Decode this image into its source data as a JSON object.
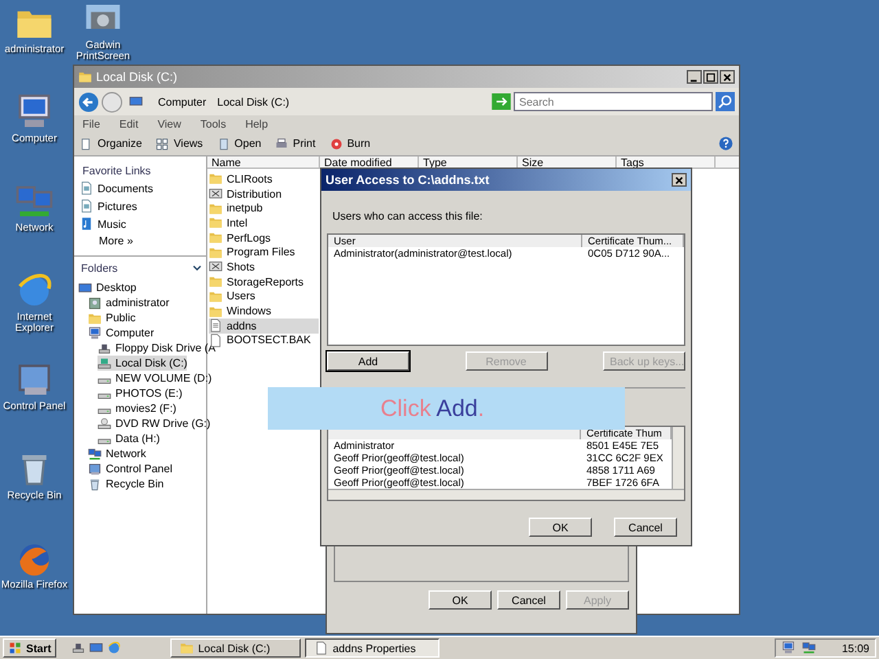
{
  "desktop_icons": [
    {
      "label": "administrator",
      "kind": "folder"
    },
    {
      "label": "Gadwin PrintScreen",
      "kind": "camera"
    },
    {
      "label": "Computer",
      "kind": "computer"
    },
    {
      "label": "Network",
      "kind": "network"
    },
    {
      "label": "Internet Explorer",
      "kind": "ie"
    },
    {
      "label": "Control Panel",
      "kind": "control"
    },
    {
      "label": "Recycle Bin",
      "kind": "bin"
    },
    {
      "label": "Mozilla Firefox",
      "kind": "firefox"
    }
  ],
  "explorer": {
    "title": "Local Disk (C:)",
    "address": [
      "Computer",
      "Local Disk (C:)"
    ],
    "search": {
      "placeholder": "Search"
    },
    "menu": [
      "File",
      "Edit",
      "View",
      "Tools",
      "Help"
    ],
    "toolbar": [
      {
        "label": "Organize",
        "kind": "organize"
      },
      {
        "label": "Views",
        "kind": "views"
      },
      {
        "label": "Open",
        "kind": "open"
      },
      {
        "label": "Print",
        "kind": "print"
      },
      {
        "label": "Burn",
        "kind": "burn"
      }
    ],
    "favorite_links": {
      "title": "Favorite Links",
      "items": [
        {
          "label": "Documents",
          "kind": "doc"
        },
        {
          "label": "Pictures",
          "kind": "doc"
        },
        {
          "label": "Music",
          "kind": "music"
        }
      ],
      "more": "More  »"
    },
    "folders": {
      "title": "Folders",
      "tree": [
        {
          "label": "Desktop",
          "kind": "desktop",
          "selected": false,
          "children": [
            {
              "label": "administrator",
              "kind": "user",
              "selected": false
            },
            {
              "label": "Public",
              "kind": "folder",
              "selected": false
            },
            {
              "label": "Computer",
              "kind": "computer",
              "selected": false,
              "children": [
                {
                  "label": "Floppy Disk Drive (A",
                  "kind": "floppy",
                  "selected": false
                },
                {
                  "label": "Local Disk (C:)",
                  "kind": "sysdrive",
                  "selected": true
                },
                {
                  "label": "NEW VOLUME (D:)",
                  "kind": "drive",
                  "selected": false
                },
                {
                  "label": "PHOTOS (E:)",
                  "kind": "drive",
                  "selected": false
                },
                {
                  "label": "movies2 (F:)",
                  "kind": "drive",
                  "selected": false
                },
                {
                  "label": "DVD RW Drive (G:)",
                  "kind": "dvd",
                  "selected": false
                },
                {
                  "label": "Data (H:)",
                  "kind": "drive",
                  "selected": false
                }
              ]
            },
            {
              "label": "Network",
              "kind": "network",
              "selected": false
            },
            {
              "label": "Control Panel",
              "kind": "control",
              "selected": false
            },
            {
              "label": "Recycle Bin",
              "kind": "bin",
              "selected": false
            }
          ]
        }
      ]
    },
    "columns": [
      "Name",
      "Date modified",
      "Type",
      "Size",
      "Tags"
    ],
    "files": [
      {
        "name": "CLIRoots",
        "kind": "folder",
        "selected": false
      },
      {
        "name": "Distribution",
        "kind": "special",
        "selected": false
      },
      {
        "name": "inetpub",
        "kind": "folder",
        "selected": false
      },
      {
        "name": "Intel",
        "kind": "folder",
        "selected": false
      },
      {
        "name": "PerfLogs",
        "kind": "folder",
        "selected": false
      },
      {
        "name": "Program Files",
        "kind": "folder",
        "selected": false
      },
      {
        "name": "Shots",
        "kind": "special",
        "selected": false
      },
      {
        "name": "StorageReports",
        "kind": "folder",
        "selected": false
      },
      {
        "name": "Users",
        "kind": "folder",
        "selected": false
      },
      {
        "name": "Windows",
        "kind": "folder",
        "selected": false
      },
      {
        "name": "addns",
        "kind": "text",
        "selected": true
      },
      {
        "name": "BOOTSECT.BAK",
        "kind": "file",
        "selected": false
      }
    ]
  },
  "properties_dialog": {
    "buttons": [
      {
        "label": "OK",
        "disabled": false
      },
      {
        "label": "Cancel",
        "disabled": false
      },
      {
        "label": "Apply",
        "disabled": true
      }
    ]
  },
  "user_access_dialog": {
    "title": "User Access to C:\\addns.txt",
    "prompt": "Users who can access this file:",
    "users_columns": [
      "User",
      "Certificate Thum..."
    ],
    "users": [
      [
        "Administrator(administrator@test.local)",
        "0C05 D712 90A..."
      ]
    ],
    "buttons": [
      {
        "label": "Add",
        "disabled": false
      },
      {
        "label": "Remove",
        "disabled": true
      },
      {
        "label": "Back up keys...",
        "disabled": true
      }
    ],
    "recovery_columns": [
      "",
      "Certificate Thum"
    ],
    "recovery": [
      [
        "Administrator",
        "8501 E45E 7E5"
      ],
      [
        "Geoff Prior(geoff@test.local)",
        "31CC 6C2F 9EX"
      ],
      [
        "Geoff Prior(geoff@test.local)",
        "4858 1711 A69"
      ],
      [
        "Geoff Prior(geoff@test.local)",
        "7BEF 1726 6FA"
      ]
    ],
    "footer_buttons": [
      "OK",
      "Cancel"
    ]
  },
  "callout": [
    {
      "text": "Click ",
      "color": "#e8808e"
    },
    {
      "text": "Add",
      "color": "#3a3f9c"
    },
    {
      "text": ".",
      "color": "#e8808e"
    }
  ],
  "taskbar": {
    "start": "Start",
    "tasks": [
      {
        "label": "Local Disk (C:)",
        "selected": false
      },
      {
        "label": "addns Properties",
        "selected": true
      }
    ],
    "clock": "15:09"
  }
}
